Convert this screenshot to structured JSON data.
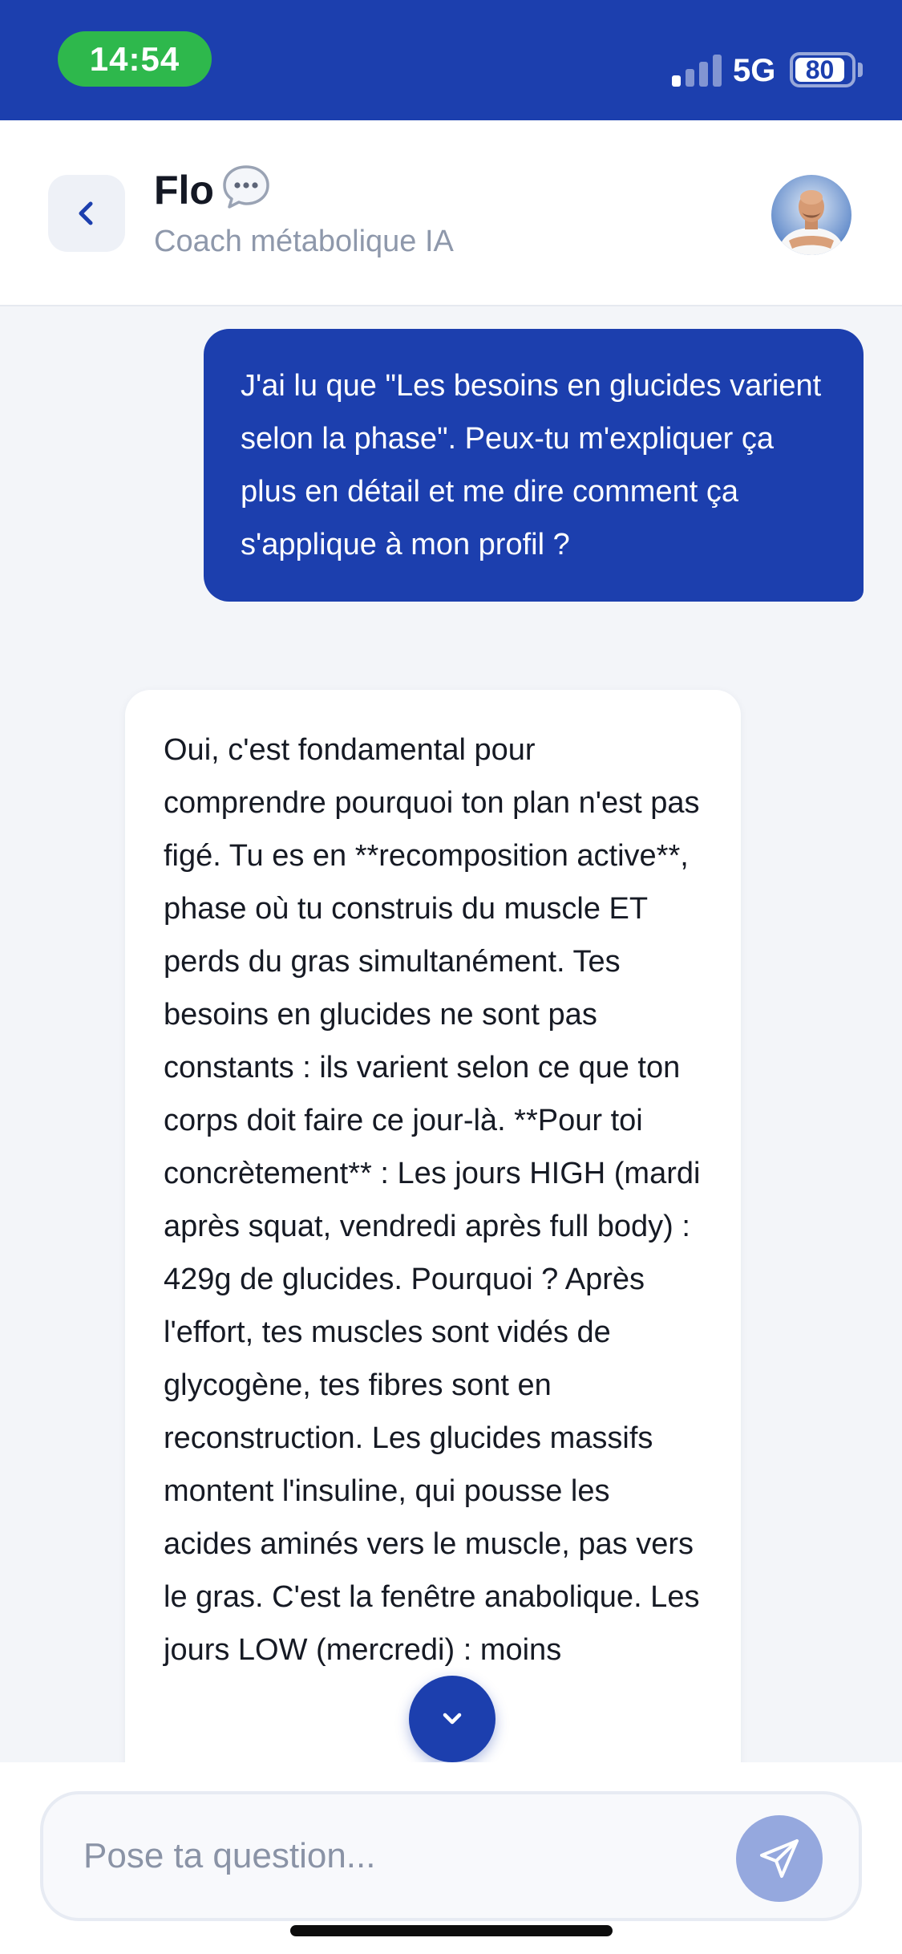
{
  "status_bar": {
    "time": "14:54",
    "network": "5G",
    "battery": "80",
    "signal_bars_active": 1,
    "signal_bars_total": 4
  },
  "header": {
    "name": "Flo",
    "subtitle": "Coach métabolique IA",
    "name_icon": "speech-bubble-icon",
    "back_icon": "chevron-left-icon"
  },
  "messages": [
    {
      "role": "user",
      "text": "J'ai lu que \"Les besoins en glucides varient selon la phase\". Peux-tu m'expliquer ça plus en détail et me dire comment ça s'applique à mon profil ?"
    },
    {
      "role": "coach",
      "text": "Oui, c'est fondamental pour comprendre pourquoi ton plan n'est pas figé. Tu es en **recomposition active**, phase où tu construis du muscle ET perds du gras simultanément. Tes besoins en glucides ne sont pas constants : ils varient selon ce que ton corps doit faire ce jour-là. **Pour toi concrètement** : Les jours HIGH (mardi après squat, vendredi après full body) : 429g de glucides. Pourquoi ? Après l'effort, tes muscles sont vidés de glycogène, tes fibres sont en reconstruction. Les glucides massifs montent l'insuline, qui pousse les acides aminés vers le muscle, pas vers le gras. C'est la fenêtre anabolique. Les jours LOW (mercredi) : moins"
    }
  ],
  "scroll_button_icon": "chevron-down-icon",
  "input": {
    "placeholder": "Pose ta question...",
    "send_icon": "send-icon"
  },
  "colors": {
    "primary": "#1c3fae",
    "status_pill": "#2eb84c",
    "send_disabled": "#95a8de",
    "background": "#f3f5f9"
  }
}
